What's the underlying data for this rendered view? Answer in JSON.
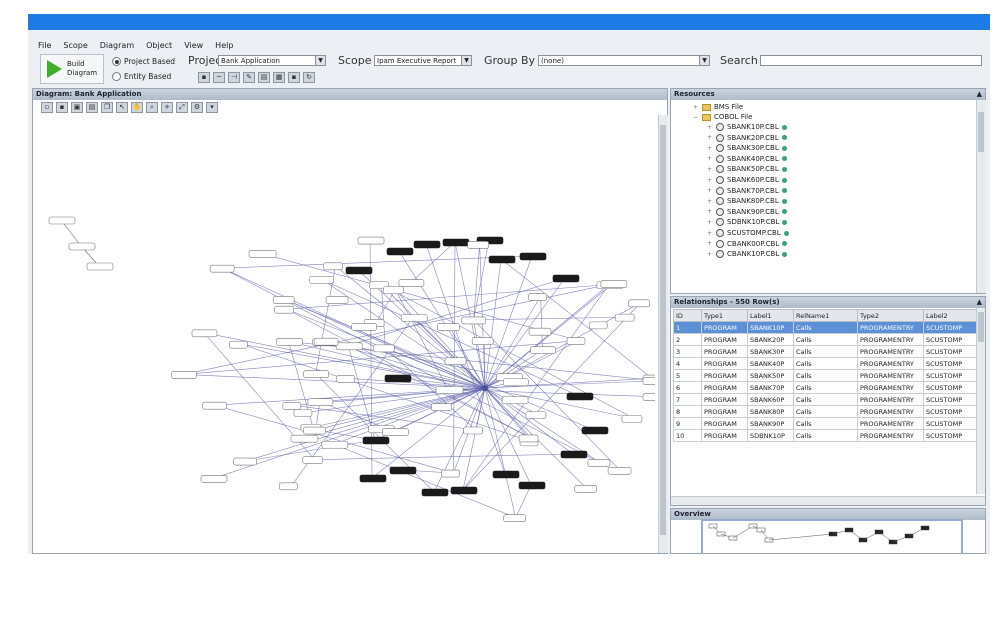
{
  "menu": [
    "File",
    "Scope",
    "Diagram",
    "Object",
    "View",
    "Help"
  ],
  "toolbar": {
    "build_label_1": "Build",
    "build_label_2": "Diagram",
    "project_based": "Project Based",
    "entity_based": "Entity Based",
    "project_label": "Project",
    "project_value": "Bank Application",
    "scope_label": "Scope",
    "scope_value": "Ipam Executive Report",
    "groupby_label": "Group By",
    "groupby_value": "(none)",
    "search_label": "Search",
    "search_value": ""
  },
  "diagram": {
    "header": "Diagram: Bank Application"
  },
  "resources": {
    "header": "Resources",
    "folders": [
      "BMS File",
      "COBOL File"
    ],
    "files": [
      "SBANK10P.CBL",
      "SBANK20P.CBL",
      "SBANK30P.CBL",
      "SBANK40P.CBL",
      "SBANK50P.CBL",
      "SBANK60P.CBL",
      "SBANK70P.CBL",
      "SBANK80P.CBL",
      "SBANK90P.CBL",
      "SDBNK10P.CBL",
      "SCUSTOMP.CBL",
      "CBANK00P.CBL",
      "CBANK10P.CBL"
    ]
  },
  "relationships": {
    "header": "Relationships - 550 Row(s)",
    "columns": [
      "ID",
      "Type1",
      "Label1",
      "RelName1",
      "Type2",
      "Label2"
    ],
    "rows": [
      [
        "1",
        "PROGRAM",
        "SBANK10P",
        "Calls",
        "PROGRAMENTRY",
        "SCUSTOMP"
      ],
      [
        "2",
        "PROGRAM",
        "SBANK20P",
        "Calls",
        "PROGRAMENTRY",
        "SCUSTOMP"
      ],
      [
        "3",
        "PROGRAM",
        "SBANK30P",
        "Calls",
        "PROGRAMENTRY",
        "SCUSTOMP"
      ],
      [
        "4",
        "PROGRAM",
        "SBANK40P",
        "Calls",
        "PROGRAMENTRY",
        "SCUSTOMP"
      ],
      [
        "5",
        "PROGRAM",
        "SBANK50P",
        "Calls",
        "PROGRAMENTRY",
        "SCUSTOMP"
      ],
      [
        "6",
        "PROGRAM",
        "SBANK70P",
        "Calls",
        "PROGRAMENTRY",
        "SCUSTOMP"
      ],
      [
        "7",
        "PROGRAM",
        "SBANK60P",
        "Calls",
        "PROGRAMENTRY",
        "SCUSTOMP"
      ],
      [
        "8",
        "PROGRAM",
        "SBANK80P",
        "Calls",
        "PROGRAMENTRY",
        "SCUSTOMP"
      ],
      [
        "9",
        "PROGRAM",
        "SBANK90P",
        "Calls",
        "PROGRAMENTRY",
        "SCUSTOMP"
      ],
      [
        "10",
        "PROGRAM",
        "SDBNK10P",
        "Calls",
        "PROGRAMENTRY",
        "SCUSTOMP"
      ]
    ]
  },
  "overview": {
    "header": "Overview"
  },
  "colors": {
    "titlebar": "#1f7be6",
    "run": "#3fae2a",
    "selected_row": "#5b8fd6",
    "edge": "#5a5fa8",
    "node_dark": "#1a1a1a"
  }
}
